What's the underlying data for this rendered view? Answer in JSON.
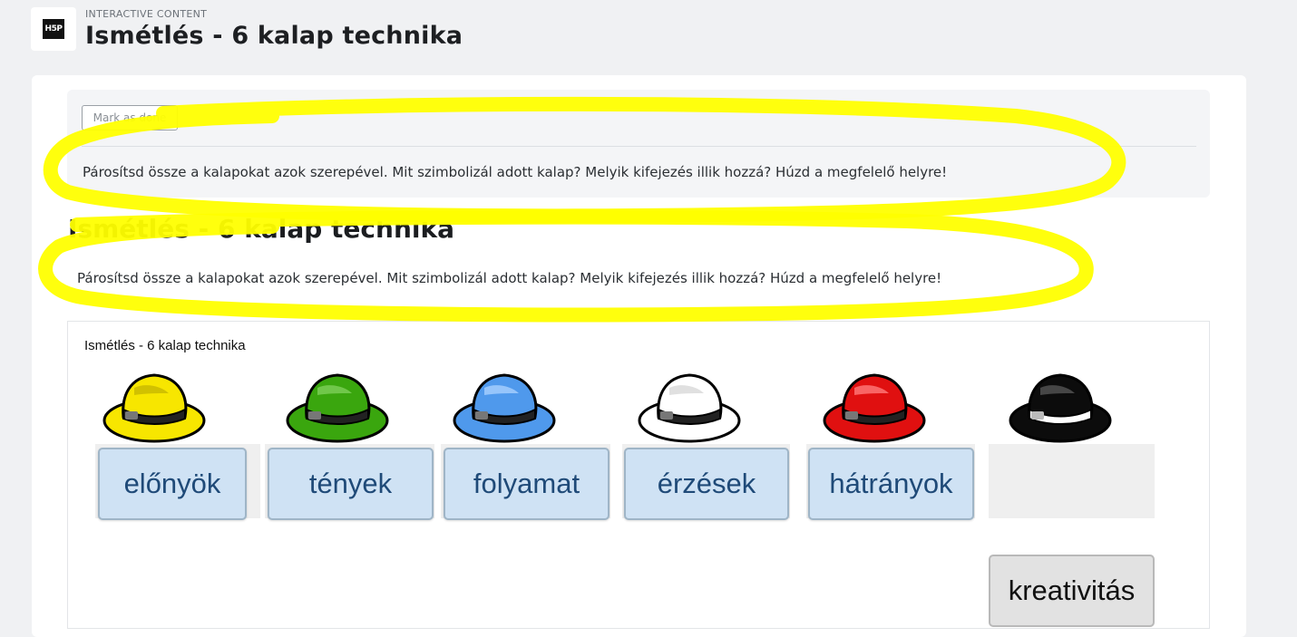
{
  "header": {
    "logo_text": "H5P",
    "eyebrow": "INTERACTIVE CONTENT",
    "title": "Ismétlés - 6 kalap technika"
  },
  "task_panel": {
    "mark_done_label": "Mark as done",
    "instruction": "Párosítsd össze a kalapokat azok szerepével. Mit szimbolizál adott kalap? Melyik kifejezés illik hozzá? Húzd a megfelelő helyre!"
  },
  "content": {
    "heading": "Ismétlés - 6 kalap technika",
    "instruction": "Párosítsd össze a kalapokat azok szerepével. Mit szimbolizál adott kalap? Melyik kifejezés illik hozzá? Húzd a megfelelő helyre!"
  },
  "drag_task": {
    "title": "Ismétlés - 6 kalap technika",
    "hats": [
      {
        "color_name": "yellow",
        "fill": "#f7e600",
        "dark": "#c7b800",
        "placed_word": "előnyök"
      },
      {
        "color_name": "green",
        "fill": "#3aa60e",
        "dark": "#2a7d0a",
        "placed_word": "tények"
      },
      {
        "color_name": "blue",
        "fill": "#4f99ec",
        "dark": "#3774bf",
        "placed_word": "folyamat"
      },
      {
        "color_name": "white",
        "fill": "#ffffff",
        "dark": "#cfcfcf",
        "placed_word": "érzések"
      },
      {
        "color_name": "red",
        "fill": "#e01010",
        "dark": "#a80b0b",
        "placed_word": "hátrányok"
      },
      {
        "color_name": "black",
        "fill": "#0c0c0c",
        "dark": "#333333",
        "placed_word": ""
      }
    ],
    "unplaced_word": "kreativitás"
  },
  "colors": {
    "highlight": "#ffff00",
    "word_bg": "#cfe2f4",
    "word_text": "#1f4a78"
  }
}
